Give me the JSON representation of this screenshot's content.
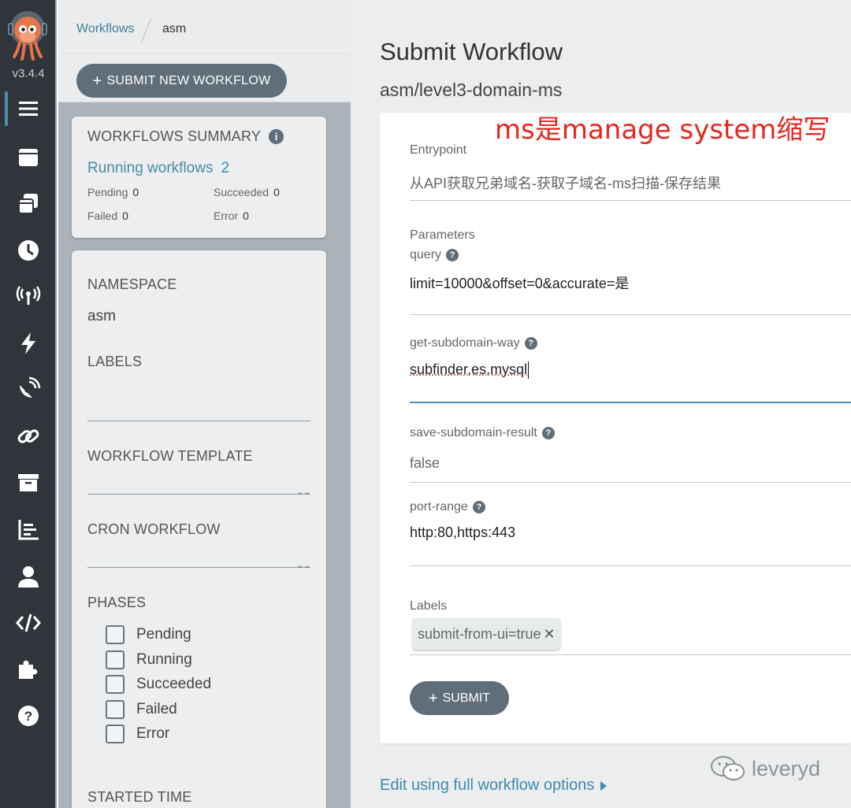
{
  "nav": {
    "version": "v3.4.4",
    "items": [
      "workflows-icon",
      "workflow-templates-icon",
      "cluster-workflow-templates-icon",
      "cron-workflows-icon",
      "event-sources-icon",
      "sensors-icon",
      "event-flow-icon",
      "links-icon",
      "archived-workflows-icon",
      "reports-icon",
      "user-icon",
      "api-docs-icon",
      "plugins-icon",
      "help-icon"
    ]
  },
  "breadcrumb": {
    "link": "Workflows",
    "current": "asm"
  },
  "submit_new_label": "SUBMIT NEW WORKFLOW",
  "summary": {
    "title": "WORKFLOWS SUMMARY",
    "running_label": "Running workflows",
    "running_count": "2",
    "pending_label": "Pending",
    "pending_count": "0",
    "succeeded_label": "Succeeded",
    "succeeded_count": "0",
    "failed_label": "Failed",
    "failed_count": "0",
    "error_label": "Error",
    "error_count": "0"
  },
  "filters": {
    "namespace_label": "NAMESPACE",
    "namespace_value": "asm",
    "labels_label": "LABELS",
    "workflow_template_label": "WORKFLOW TEMPLATE",
    "cron_workflow_label": "CRON WORKFLOW",
    "phases_label": "PHASES",
    "phases": [
      "Pending",
      "Running",
      "Succeeded",
      "Failed",
      "Error"
    ],
    "started_time_label": "STARTED TIME"
  },
  "main": {
    "title": "Submit Workflow",
    "subtitle": "asm/level3-domain-ms",
    "annotation": "ms是manage system缩写",
    "entrypoint_label": "Entrypoint",
    "entrypoint_value": "从API获取兄弟域名-获取子域名-ms扫描-保存结果",
    "parameters_label": "Parameters",
    "params": [
      {
        "name": "query",
        "value": "limit=10000&offset=0&accurate=是"
      },
      {
        "name": "get-subdomain-way",
        "value": "subfinder,es,mysql"
      },
      {
        "name": "save-subdomain-result",
        "value": "false"
      },
      {
        "name": "port-range",
        "value": "http:80,https:443"
      }
    ],
    "labels_label": "Labels",
    "label_chip": "submit-from-ui=true",
    "submit_label": "SUBMIT",
    "edit_link": "Edit using full workflow options"
  },
  "watermark": "leveryd",
  "colors": {
    "accent": "#4f8fa8",
    "annotation": "#e6261f",
    "nav_bg": "#2f353b",
    "button": "#5f6e78"
  }
}
